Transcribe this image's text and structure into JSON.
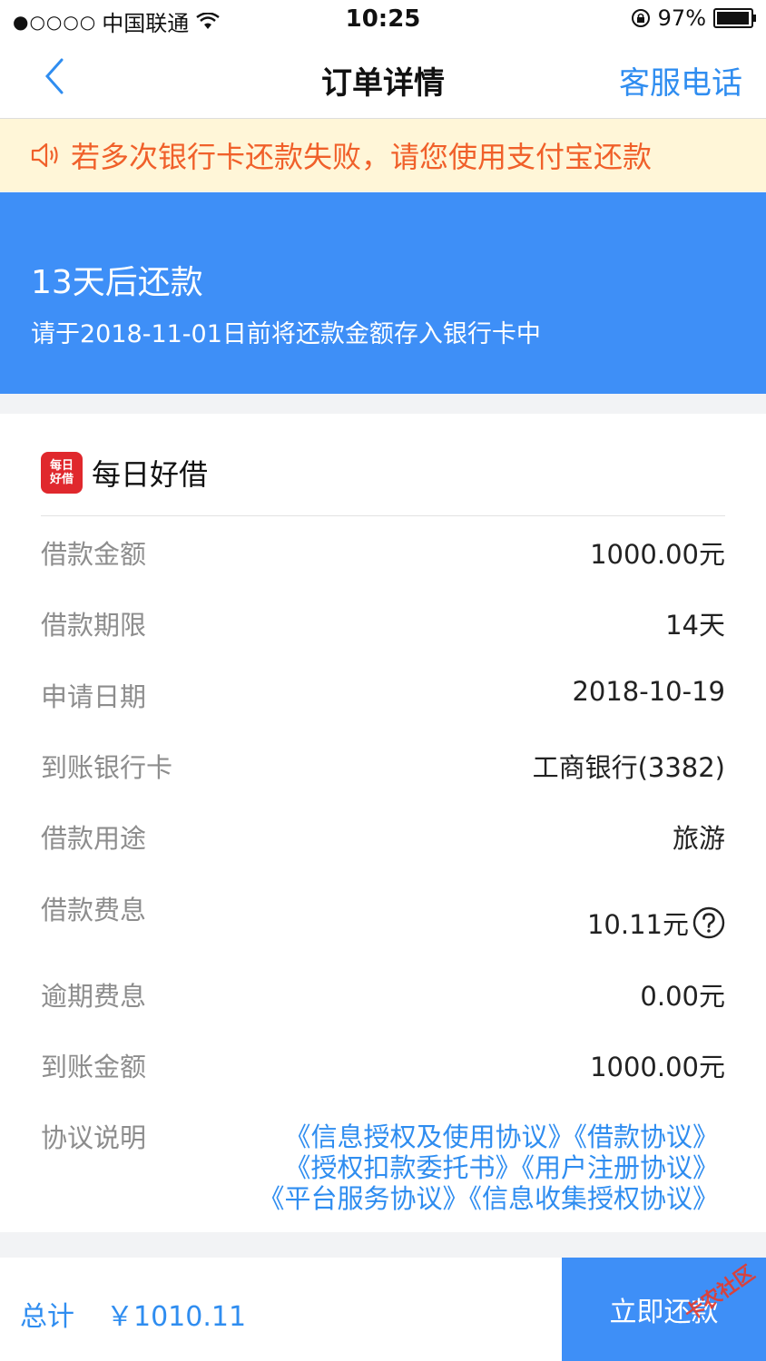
{
  "status_bar": {
    "carrier": "中国联通",
    "time": "10:25",
    "battery": "97%",
    "battery_level": 0.97
  },
  "nav": {
    "title": "订单详情",
    "service_label": "客服电话"
  },
  "notice": {
    "text": "若多次银行卡还款失败，请您使用支付宝还款"
  },
  "hero": {
    "title": "13天后还款",
    "subtitle": "请于2018-11-01日前将还款金额存入银行卡中"
  },
  "merchant": {
    "logo_line1": "每日",
    "logo_line2": "好借",
    "name": "每日好借"
  },
  "details": [
    {
      "label": "借款金额",
      "value": "1000.00元"
    },
    {
      "label": "借款期限",
      "value": "14天"
    },
    {
      "label": "申请日期",
      "value": "2018-10-19"
    },
    {
      "label": "到账银行卡",
      "value": "工商银行(3382)"
    },
    {
      "label": "借款用途",
      "value": "旅游"
    },
    {
      "label": "借款费息",
      "value": "10.11元"
    },
    {
      "label": "逾期费息",
      "value": "0.00元"
    },
    {
      "label": "到账金额",
      "value": "1000.00元"
    }
  ],
  "agreements": {
    "label": "协议说明",
    "items": [
      "《信息授权及使用协议》",
      "《借款协议》",
      "《授权扣款委托书》",
      "《用户注册协议》",
      "《平台服务协议》",
      "《信息收集授权协议》"
    ]
  },
  "footer": {
    "total_label": "总计",
    "total_amount": "￥1010.11",
    "pay_label": "立即还款"
  },
  "watermark": {
    "text": "卡农社区"
  },
  "colors": {
    "accent": "#3e8ff7",
    "link": "#2f8df0",
    "warning_text": "#f0602a",
    "notice_bg": "#fff6d8"
  }
}
